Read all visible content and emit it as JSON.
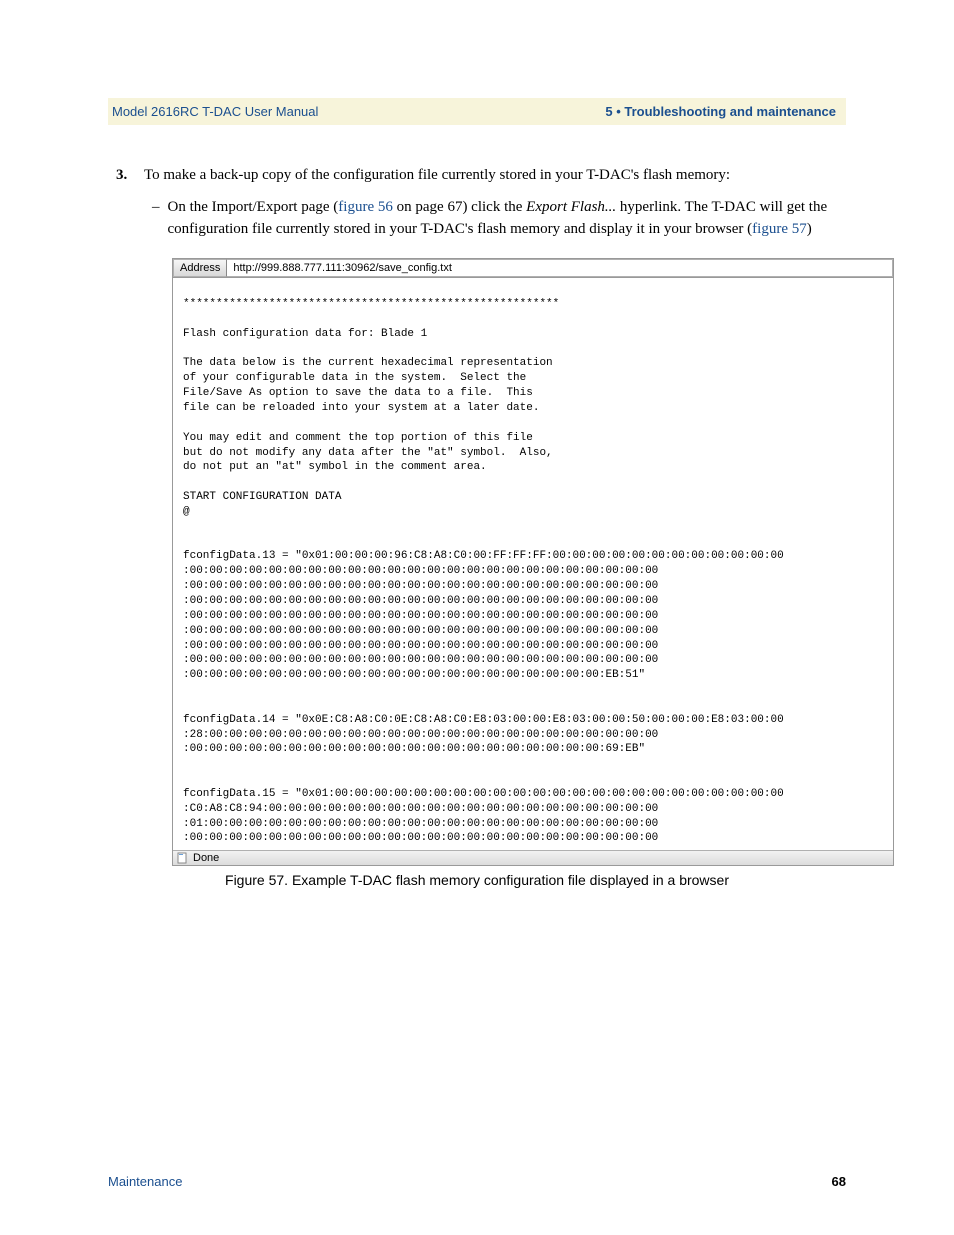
{
  "header": {
    "left": "Model 2616RC T-DAC User Manual",
    "right": "5 • Troubleshooting and maintenance"
  },
  "step": {
    "number": "3.",
    "text_a": "To make a back-up copy of the configuration file currently stored in your T-DAC's flash memory:"
  },
  "bullet": {
    "dash": "–",
    "part1": "On the Import/Export page (",
    "link1": "figure 56",
    "part2": " on page 67) click the ",
    "italic": "Export Flash...",
    "part3": " hyperlink. The T-DAC will get the configuration file currently stored in your T-DAC's flash memory and display it in your browser (",
    "link2": "figure 57",
    "part4": ")"
  },
  "browser": {
    "address_label": "Address",
    "address_value": "http://999.888.777.111:30962/save_config.txt",
    "status_text": "Done"
  },
  "console_lines": [
    "",
    "*********************************************************",
    "",
    "Flash configuration data for: Blade 1",
    "",
    "The data below is the current hexadecimal representation",
    "of your configurable data in the system.  Select the",
    "File/Save As option to save the data to a file.  This",
    "file can be reloaded into your system at a later date.",
    "",
    "You may edit and comment the top portion of this file",
    "but do not modify any data after the \"at\" symbol.  Also,",
    "do not put an \"at\" symbol in the comment area.",
    "",
    "START CONFIGURATION DATA",
    "@",
    "",
    "",
    "fconfigData.13 = \"0x01:00:00:00:96:C8:A8:C0:00:FF:FF:FF:00:00:00:00:00:00:00:00:00:00:00:00",
    ":00:00:00:00:00:00:00:00:00:00:00:00:00:00:00:00:00:00:00:00:00:00:00:00",
    ":00:00:00:00:00:00:00:00:00:00:00:00:00:00:00:00:00:00:00:00:00:00:00:00",
    ":00:00:00:00:00:00:00:00:00:00:00:00:00:00:00:00:00:00:00:00:00:00:00:00",
    ":00:00:00:00:00:00:00:00:00:00:00:00:00:00:00:00:00:00:00:00:00:00:00:00",
    ":00:00:00:00:00:00:00:00:00:00:00:00:00:00:00:00:00:00:00:00:00:00:00:00",
    ":00:00:00:00:00:00:00:00:00:00:00:00:00:00:00:00:00:00:00:00:00:00:00:00",
    ":00:00:00:00:00:00:00:00:00:00:00:00:00:00:00:00:00:00:00:00:00:00:00:00",
    ":00:00:00:00:00:00:00:00:00:00:00:00:00:00:00:00:00:00:00:00:00:EB:51\"",
    "",
    "",
    "fconfigData.14 = \"0x0E:C8:A8:C0:0E:C8:A8:C0:E8:03:00:00:E8:03:00:00:50:00:00:00:E8:03:00:00",
    ":28:00:00:00:00:00:00:00:00:00:00:00:00:00:00:00:00:00:00:00:00:00:00:00",
    ":00:00:00:00:00:00:00:00:00:00:00:00:00:00:00:00:00:00:00:00:00:69:EB\"",
    "",
    "",
    "fconfigData.15 = \"0x01:00:00:00:00:00:00:00:00:00:00:00:00:00:00:00:00:00:00:00:00:00:00:00",
    ":C0:A8:C8:94:00:00:00:00:00:00:00:00:00:00:00:00:00:00:00:00:00:00:00:00",
    ":01:00:00:00:00:00:00:00:00:00:00:00:00:00:00:00:00:00:00:00:00:00:00:00",
    ":00:00:00:00:00:00:00:00:00:00:00:00:00:00:00:00:00:00:00:00:00:00:00:00"
  ],
  "caption": "Figure 57. Example T-DAC flash memory configuration file displayed in a browser",
  "footer": {
    "left": "Maintenance",
    "right": "68"
  }
}
